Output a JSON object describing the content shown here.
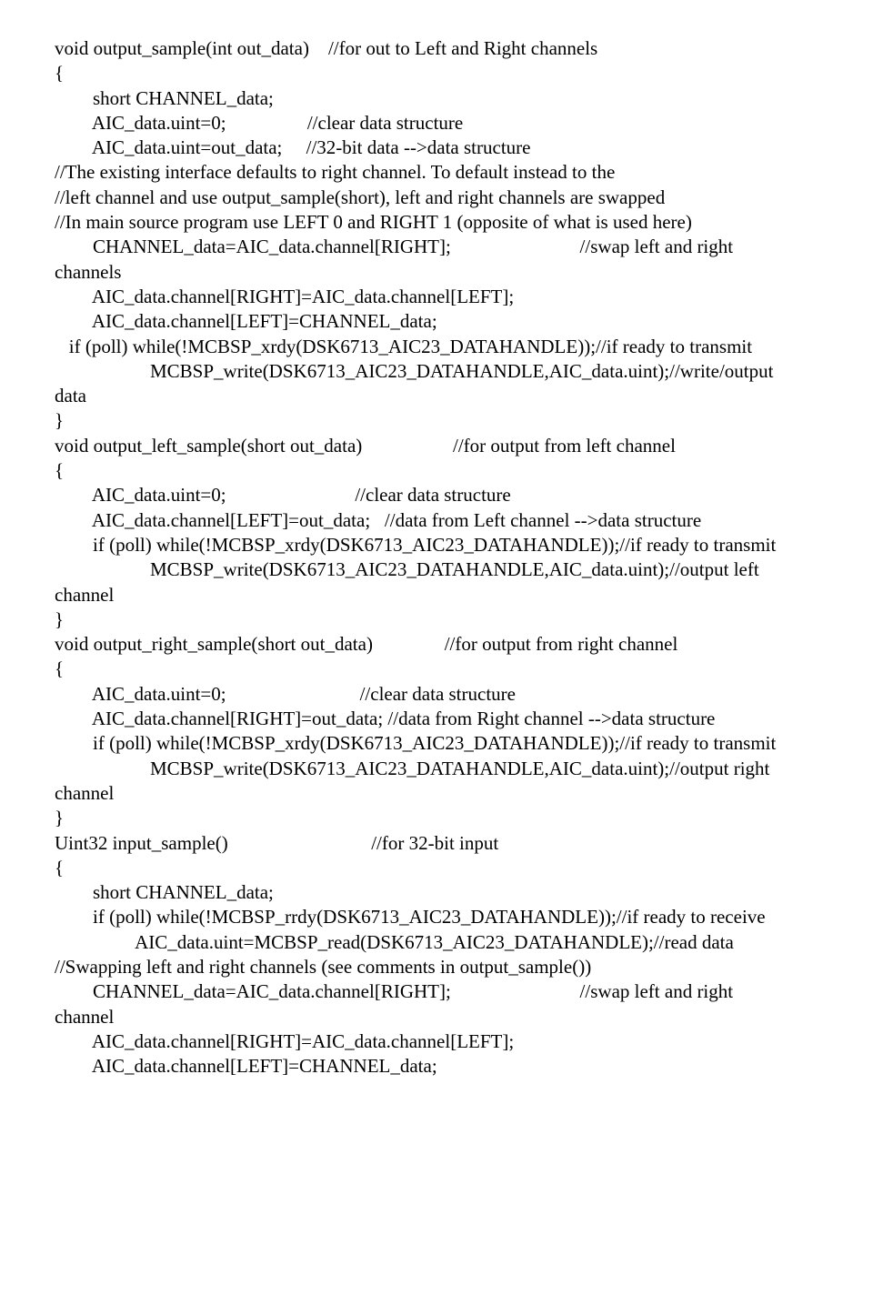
{
  "lines": {
    "l1": "void output_sample(int out_data)    //for out to Left and Right channels",
    "l2": "{",
    "l3": "        short CHANNEL_data;",
    "l4": "",
    "l5": "        AIC_data.uint=0;                 //clear data structure",
    "l6": "        AIC_data.uint=out_data;     //32-bit data -->data structure",
    "l7": "",
    "l8": "//The existing interface defaults to right channel. To default instead to the",
    "l9": "//left channel and use output_sample(short), left and right channels are swapped",
    "l10": "//In main source program use LEFT 0 and RIGHT 1 (opposite of what is used here)",
    "l11": "        CHANNEL_data=AIC_data.channel[RIGHT];                           //swap left and right",
    "l12": "channels",
    "l13": "        AIC_data.channel[RIGHT]=AIC_data.channel[LEFT];",
    "l14": "        AIC_data.channel[LEFT]=CHANNEL_data;",
    "l15": "   if (poll) while(!MCBSP_xrdy(DSK6713_AIC23_DATAHANDLE));//if ready to transmit",
    "l16": "                    MCBSP_write(DSK6713_AIC23_DATAHANDLE,AIC_data.uint);//write/output",
    "l17": "data",
    "l18": "}",
    "l19": "",
    "l20": "void output_left_sample(short out_data)                   //for output from left channel",
    "l21": "{",
    "l22": "        AIC_data.uint=0;                           //clear data structure",
    "l23": "        AIC_data.channel[LEFT]=out_data;   //data from Left channel -->data structure",
    "l24": "",
    "l25": "        if (poll) while(!MCBSP_xrdy(DSK6713_AIC23_DATAHANDLE));//if ready to transmit",
    "l26": "                    MCBSP_write(DSK6713_AIC23_DATAHANDLE,AIC_data.uint);//output left",
    "l27": "channel",
    "l28": "}",
    "l29": "",
    "l30": "void output_right_sample(short out_data)               //for output from right channel",
    "l31": "{",
    "l32": "        AIC_data.uint=0;                            //clear data structure",
    "l33": "        AIC_data.channel[RIGHT]=out_data; //data from Right channel -->data structure",
    "l34": "",
    "l35": "        if (poll) while(!MCBSP_xrdy(DSK6713_AIC23_DATAHANDLE));//if ready to transmit",
    "l36": "                    MCBSP_write(DSK6713_AIC23_DATAHANDLE,AIC_data.uint);//output right",
    "l37": "channel",
    "l38": "}",
    "l39": "",
    "l40": "Uint32 input_sample()                              //for 32-bit input",
    "l41": "{",
    "l42": "        short CHANNEL_data;",
    "l43": "",
    "l44": "        if (poll) while(!MCBSP_rrdy(DSK6713_AIC23_DATAHANDLE));//if ready to receive",
    "l45": "                 AIC_data.uint=MCBSP_read(DSK6713_AIC23_DATAHANDLE);//read data",
    "l46": "",
    "l47": "//Swapping left and right channels (see comments in output_sample())",
    "l48": "        CHANNEL_data=AIC_data.channel[RIGHT];                           //swap left and right",
    "l49": "channel",
    "l50": "        AIC_data.channel[RIGHT]=AIC_data.channel[LEFT];",
    "l51": "        AIC_data.channel[LEFT]=CHANNEL_data;"
  }
}
